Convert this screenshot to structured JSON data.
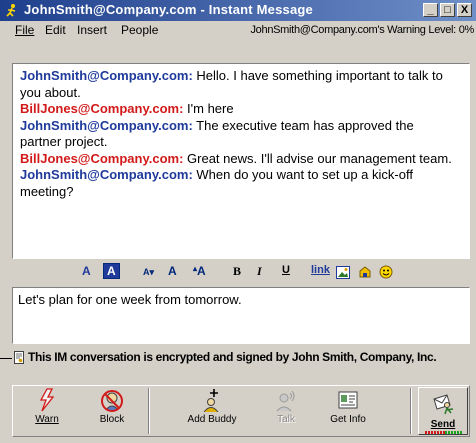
{
  "window": {
    "title": "JohnSmith@Company.com - Instant Message",
    "controls": {
      "minimize": "_",
      "maximize": "□",
      "close": "X"
    }
  },
  "menu": {
    "items": [
      {
        "label": "File"
      },
      {
        "label": "Edit"
      },
      {
        "label": "Insert"
      },
      {
        "label": "People"
      }
    ],
    "warning_status": "JohnSmith@Company.com's Warning Level: 0%"
  },
  "conversation": {
    "messages": [
      {
        "sender": "JohnSmith@Company.com:",
        "text": " Hello. I have something important to talk to you about."
      },
      {
        "sender": "BillJones@Company.com:",
        "text": " I'm here"
      },
      {
        "sender": "JohnSmith@Company.com:",
        "text": " The executive team has approved the partner project."
      },
      {
        "sender": "BillJones@Company.com:",
        "text": " Great news. I'll advise our management team."
      },
      {
        "sender": "JohnSmith@Company.com:",
        "text": " When do you want to set up a kick-off meeting?"
      }
    ]
  },
  "format_toolbar": {
    "text_color": "A",
    "background_color": "A",
    "smaller_font": "A▾",
    "normal_font": "A",
    "larger_font": "A",
    "bold": "B",
    "italic": "I",
    "underline": "U",
    "link": "link"
  },
  "compose": {
    "value": "Let's plan for one week from tomorrow."
  },
  "encryption": {
    "status": "This IM conversation is encrypted and signed by John Smith, Company, Inc."
  },
  "toolbar": {
    "warn": "Warn",
    "block": "Block",
    "add_buddy": "Add Buddy",
    "talk": "Talk",
    "get_info": "Get Info",
    "send": "Send"
  },
  "colors": {
    "title_bar_start": "#1e3f8c",
    "title_bar_end": "#6f8fc8",
    "john_sender": "#1f3a9b",
    "bill_sender": "#d21a1a",
    "chrome": "#d4d0c8"
  }
}
